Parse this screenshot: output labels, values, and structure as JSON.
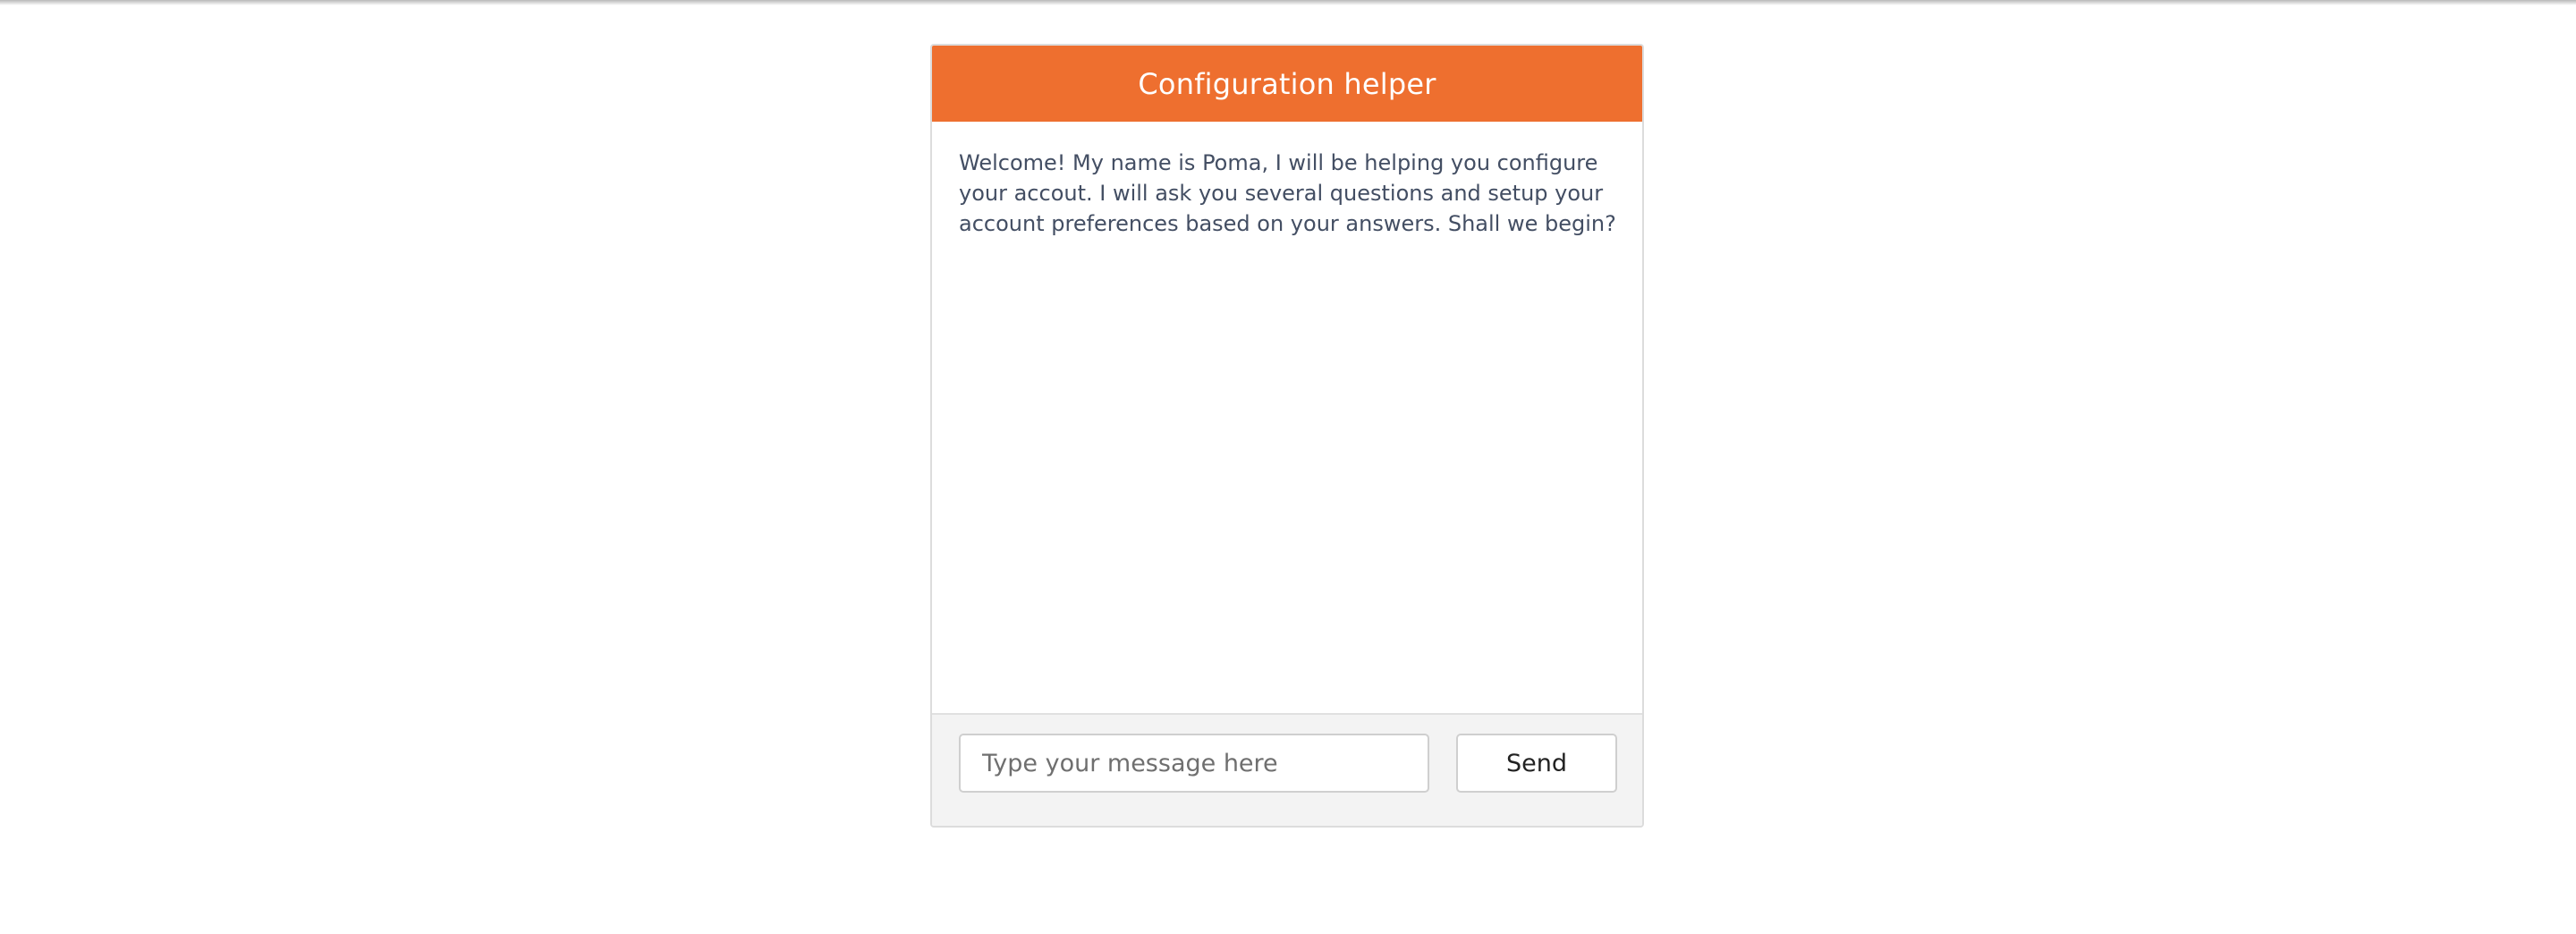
{
  "chat": {
    "title": "Configuration helper",
    "messages": [
      "Welcome! My name is Poma, I will be helping you configure your accout. I will ask you several questions and setup your account preferences based on your answers. Shall we begin?"
    ],
    "input": {
      "value": "",
      "placeholder": "Type your message here"
    },
    "send_label": "Send"
  },
  "colors": {
    "header_background": "#ee6f2f",
    "header_text": "#ffffff",
    "message_text": "#434e63",
    "footer_background": "#f3f3f3"
  }
}
